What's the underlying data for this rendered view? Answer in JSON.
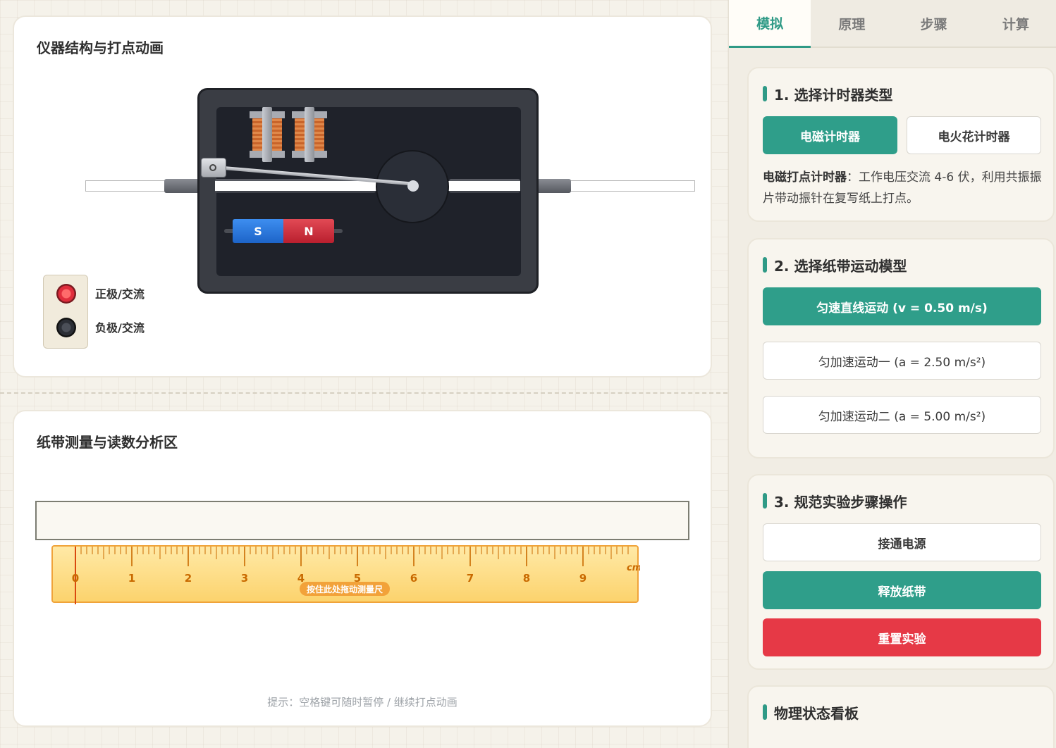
{
  "top_card": {
    "title": "仪器结构与打点动画"
  },
  "instrument": {
    "magnet_s": "S",
    "magnet_n": "N",
    "terminal_positive": "正极/交流",
    "terminal_negative": "负极/交流"
  },
  "bottom_card": {
    "title": "纸带测量与读数分析区",
    "ruler_ticks": [
      "0",
      "1",
      "2",
      "3",
      "4",
      "5",
      "6",
      "7",
      "8",
      "9"
    ],
    "ruler_unit": "cm",
    "drag_hint": "按住此处拖动测量尺",
    "hint": "提示：空格键可随时暂停 / 继续打点动画"
  },
  "tabs": [
    {
      "label": "模拟",
      "active": true
    },
    {
      "label": "原理",
      "active": false
    },
    {
      "label": "步骤",
      "active": false
    },
    {
      "label": "计算",
      "active": false
    }
  ],
  "panel_timer": {
    "title": "1. 选择计时器类型",
    "option_em": "电磁计时器",
    "option_spark": "电火花计时器",
    "desc_label": "电磁打点计时器",
    "desc_text": "：工作电压交流 4-6 伏，利用共振振片带动振针在复写纸上打点。"
  },
  "panel_motion": {
    "title": "2. 选择纸带运动模型",
    "option_uniform": "匀速直线运动 (v = 0.50 m/s)",
    "option_accel1": "匀加速运动一 (a = 2.50 m/s²)",
    "option_accel2": "匀加速运动二 (a = 5.00 m/s²)"
  },
  "panel_steps": {
    "title": "3. 规范实验步骤操作",
    "connect_power": "接通电源",
    "release_tape": "释放纸带",
    "reset": "重置实验"
  },
  "panel_status": {
    "title": "物理状态看板"
  },
  "colors": {
    "accent": "#2f9e8a",
    "danger": "#e63946",
    "ruler": "#fcd36d"
  }
}
